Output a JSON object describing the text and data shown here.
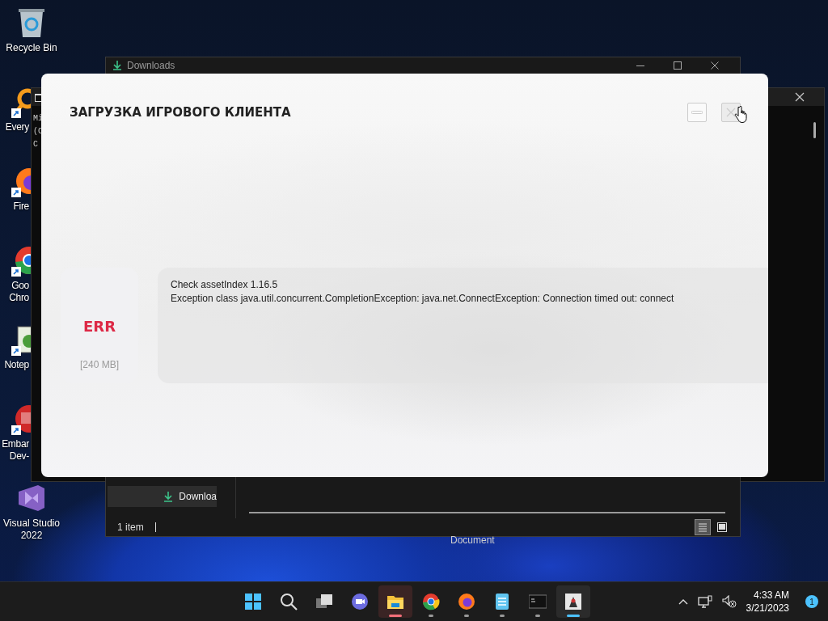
{
  "desktop_icons": [
    {
      "kind": "recycle",
      "label": "Recycle Bin",
      "covered": false
    },
    {
      "kind": "search",
      "label": "Every",
      "covered": true
    },
    {
      "kind": "firefox",
      "label": "Fire",
      "covered": true
    },
    {
      "kind": "chrome",
      "label": "Goo\nChro",
      "covered": true
    },
    {
      "kind": "notepad",
      "label": "Notep",
      "covered": true
    },
    {
      "kind": "devcpp",
      "label": "Embar\nDev-",
      "covered": true
    },
    {
      "kind": "vs",
      "label": "Visual Studio\n2022",
      "covered": false
    }
  ],
  "terminal_window": {
    "lines": [
      "Mi",
      "(C",
      "C"
    ]
  },
  "explorer_window": {
    "title": "Downloads",
    "sidebar_items": [
      {
        "label": "Downloa",
        "selected": true
      }
    ],
    "status": "1 item",
    "views": [
      {
        "kind": "details",
        "selected": true
      },
      {
        "kind": "tiles",
        "selected": false
      }
    ]
  },
  "drag_label": "Document",
  "dialog": {
    "title": "ЗАГРУЗКА ИГРОВОГО КЛИЕНТА",
    "close_hovered": true,
    "download_card": {
      "status": "ERR",
      "size": "[240 MB]"
    },
    "log": [
      "Check assetIndex 1.16.5",
      "Exception class java.util.concurrent.CompletionException: java.net.ConnectException: Connection timed out: connect"
    ]
  },
  "taskbar": {
    "apps": [
      {
        "kind": "start",
        "running": false,
        "focused": false,
        "flashing": false
      },
      {
        "kind": "search",
        "running": false,
        "focused": false,
        "flashing": false
      },
      {
        "kind": "taskview",
        "running": false,
        "focused": false,
        "flashing": false
      },
      {
        "kind": "chat",
        "running": false,
        "focused": false,
        "flashing": false
      },
      {
        "kind": "explorer",
        "running": true,
        "focused": false,
        "flashing": true
      },
      {
        "kind": "chrome",
        "running": true,
        "focused": false,
        "flashing": false
      },
      {
        "kind": "firefox",
        "running": true,
        "focused": false,
        "flashing": false
      },
      {
        "kind": "notepad",
        "running": true,
        "focused": false,
        "flashing": false
      },
      {
        "kind": "terminal",
        "running": true,
        "focused": false,
        "flashing": false
      },
      {
        "kind": "java",
        "running": true,
        "focused": true,
        "flashing": false
      }
    ],
    "clock": {
      "time": "4:33 AM",
      "date": "3/21/2023"
    },
    "notification_count": "1"
  }
}
